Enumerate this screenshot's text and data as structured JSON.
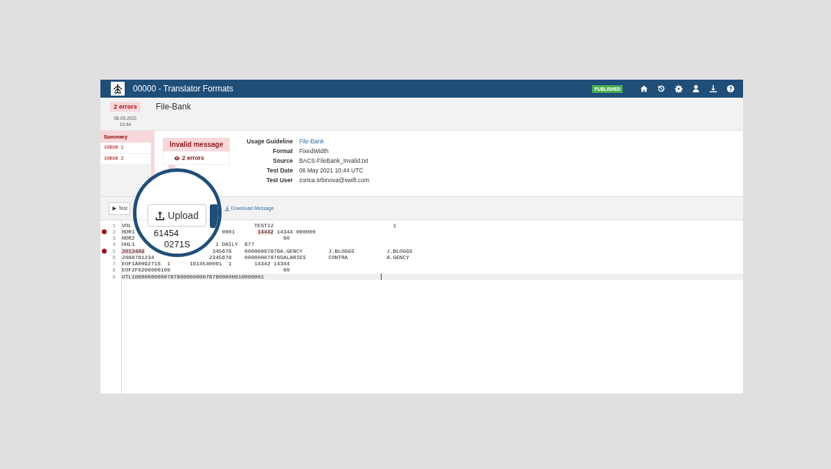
{
  "header": {
    "title": "00000 - Translator Formats",
    "status": "PUBLISHED"
  },
  "summary": {
    "badge": "2 errors",
    "date": "06-05-2021",
    "time": "10:44",
    "name": "File-Bank"
  },
  "sidebar": {
    "title": "Summary",
    "items": [
      {
        "label": "ERROR 1",
        "selected": false
      },
      {
        "label": "ERROR 2",
        "selected": false
      }
    ]
  },
  "result": {
    "title": "Invalid message",
    "errors": "2 errors"
  },
  "details": [
    {
      "label": "Usage Guideline",
      "value": "File-Bank",
      "kind": "link"
    },
    {
      "label": "Format",
      "value": "FixedWidth",
      "kind": "text"
    },
    {
      "label": "Source",
      "value": "BACS-FileBank_Invalid.txt",
      "kind": "text"
    },
    {
      "label": "Test Date",
      "value": "06 May 2021 10:44 UTC",
      "kind": "text"
    },
    {
      "label": "Test User",
      "value": "zorica.srbinova@swift.com",
      "kind": "text"
    }
  ],
  "toolbar": {
    "test": "Test",
    "download": "Download Message"
  },
  "magnifier": {
    "upload": "Upload",
    "fragments": [
      "61454",
      "0271S"
    ]
  },
  "editor": {
    "lines": [
      {
        "number": "1",
        "error": false,
        "active": false,
        "segments": [
          {
            "text": "VOL                                      TEST12                                     1",
            "highlighted": false
          }
        ]
      },
      {
        "number": "2",
        "error": true,
        "active": false,
        "segments": [
          {
            "text": "HDR1                           0001       ",
            "highlighted": false
          },
          {
            "text": "14442",
            "highlighted": true
          },
          {
            "text": " 14344 000000",
            "highlighted": false
          }
        ]
      },
      {
        "number": "3",
        "error": false,
        "active": false,
        "segments": [
          {
            "text": "HDR2                                              00",
            "highlighted": false
          }
        ]
      },
      {
        "number": "4",
        "error": false,
        "active": false,
        "segments": [
          {
            "text": "UHL1                         1 DAILY  677",
            "highlighted": false
          }
        ]
      },
      {
        "number": "5",
        "error": true,
        "active": false,
        "segments": [
          {
            "text": "20134A9",
            "highlighted": true
          },
          {
            "text": "                     345678    00000007876A.GENCY        J.BLOGGS          J.BLOGGS",
            "highlighted": false
          }
        ]
      },
      {
        "number": "6",
        "error": false,
        "active": false,
        "segments": [
          {
            "text": "2098761234                 2345678    00000007876SALARIES       CONTRA            A.GENCY",
            "highlighted": false
          }
        ]
      },
      {
        "number": "7",
        "error": false,
        "active": false,
        "segments": [
          {
            "text": "EOF1A009271S  1      1614540001  1       14342 14344",
            "highlighted": false
          }
        ]
      },
      {
        "number": "8",
        "error": false,
        "active": false,
        "segments": [
          {
            "text": "EOF2F0200000100                                   00",
            "highlighted": false
          }
        ]
      },
      {
        "number": "9",
        "error": false,
        "active": true,
        "segments": [
          {
            "text": "UTL10000000000787600000000787600000010000001",
            "highlighted": false
          }
        ]
      }
    ]
  }
}
